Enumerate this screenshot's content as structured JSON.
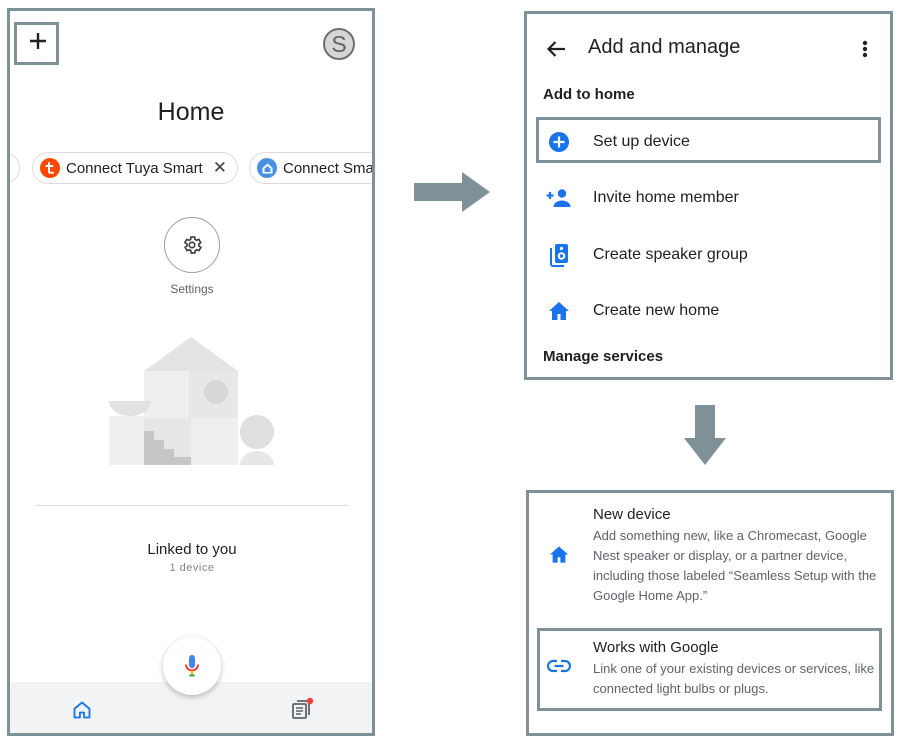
{
  "left_screen": {
    "add_icon": "plus-icon",
    "avatar_letter": "S",
    "title": "Home",
    "chips": [
      {
        "label": "Connect Tuya Smart",
        "icon": "tuya-logo-icon",
        "close": "✕"
      },
      {
        "label": "Connect Sma",
        "icon": "smart-home-icon"
      }
    ],
    "settings_label": "Settings",
    "linked_title": "Linked to you",
    "linked_sub": "1 device",
    "nav": {
      "home": "home-icon",
      "mic": "mic-icon",
      "feed": "feed-icon"
    }
  },
  "right_menu": {
    "back_icon": "arrow-back-icon",
    "title": "Add and manage",
    "more_icon": "more-vert-icon",
    "section_add": "Add to home",
    "items": [
      {
        "label": "Set up device",
        "icon": "add-circle-icon"
      },
      {
        "label": "Invite home member",
        "icon": "person-add-icon"
      },
      {
        "label": "Create speaker group",
        "icon": "speaker-group-icon"
      },
      {
        "label": "Create new home",
        "icon": "home-icon"
      }
    ],
    "section_manage": "Manage services"
  },
  "device_panel": {
    "new_device": {
      "title": "New device",
      "desc": "Add something new, like a Chromecast, Google Nest speaker or display, or a partner device, including those labeled “Seamless Setup with the Google Home App.”",
      "icon": "home-icon"
    },
    "works_with": {
      "title": "Works with Google",
      "desc": "Link one of your existing devices or services, like connected light bulbs or plugs.",
      "icon": "link-icon"
    }
  },
  "colors": {
    "frame": "#7e9196",
    "accent_blue": "#1a73e8",
    "tuya_orange": "#ff4800",
    "text": "#202124",
    "subtext": "#5f6368"
  }
}
